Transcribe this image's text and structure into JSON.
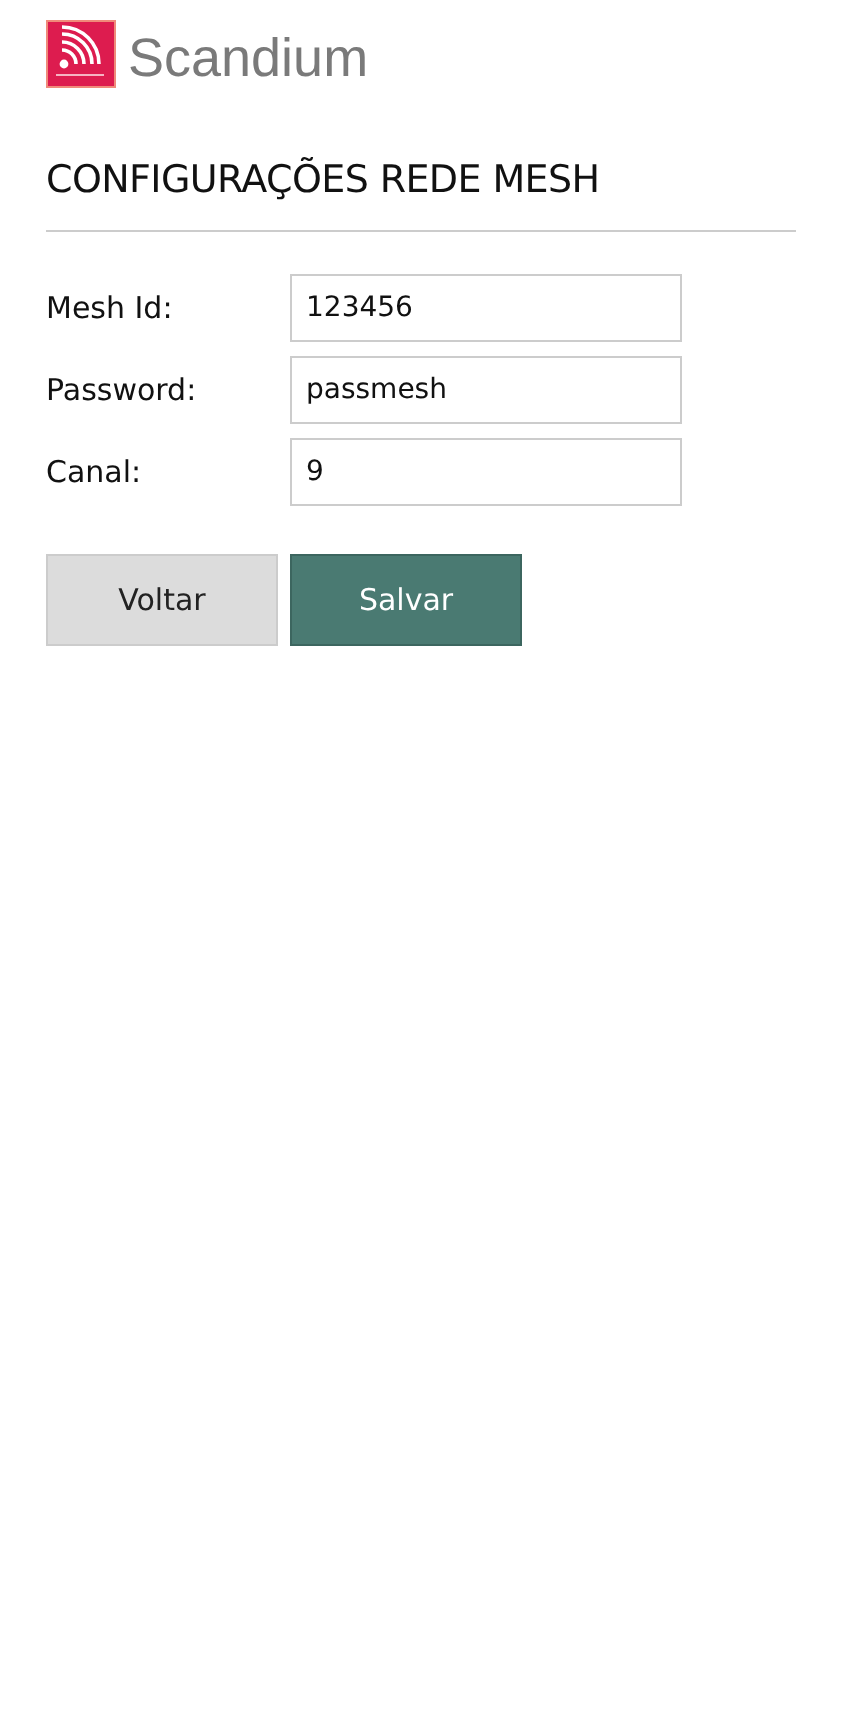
{
  "brand": {
    "name": "Scandium"
  },
  "title": "CONFIGURAÇÕES REDE MESH",
  "fields": [
    {
      "label": "Mesh Id:",
      "value": "123456"
    },
    {
      "label": "Password:",
      "value": "passmesh"
    },
    {
      "label": "Canal:",
      "value": "9"
    }
  ],
  "buttons": [
    {
      "label": "Voltar",
      "kind": "secondary"
    },
    {
      "label": "Salvar",
      "kind": "primary"
    }
  ]
}
